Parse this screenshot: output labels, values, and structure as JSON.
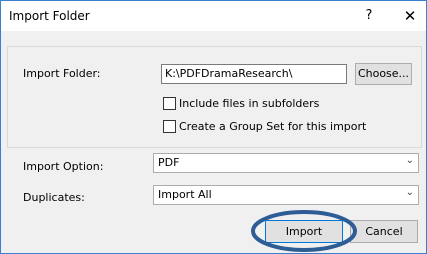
{
  "window": {
    "title": "Import Folder",
    "help_glyph": "?",
    "close_glyph": "✕"
  },
  "folder": {
    "label": "Import Folder:",
    "path": "K:\\PDFDramaResearch\\",
    "choose_label": "Choose...",
    "include_subfolders_label": "Include files in subfolders",
    "include_subfolders_checked": false,
    "group_set_label": "Create a Group Set for this import",
    "group_set_checked": false
  },
  "options": {
    "import_option_label": "Import Option:",
    "import_option_value": "PDF",
    "duplicates_label": "Duplicates:",
    "duplicates_value": "Import All"
  },
  "buttons": {
    "import_label": "Import",
    "cancel_label": "Cancel"
  },
  "annotation": {
    "color": "#2e5c95"
  },
  "colors": {
    "accent": "#0078d7",
    "window_border": "#3b7fd0"
  }
}
